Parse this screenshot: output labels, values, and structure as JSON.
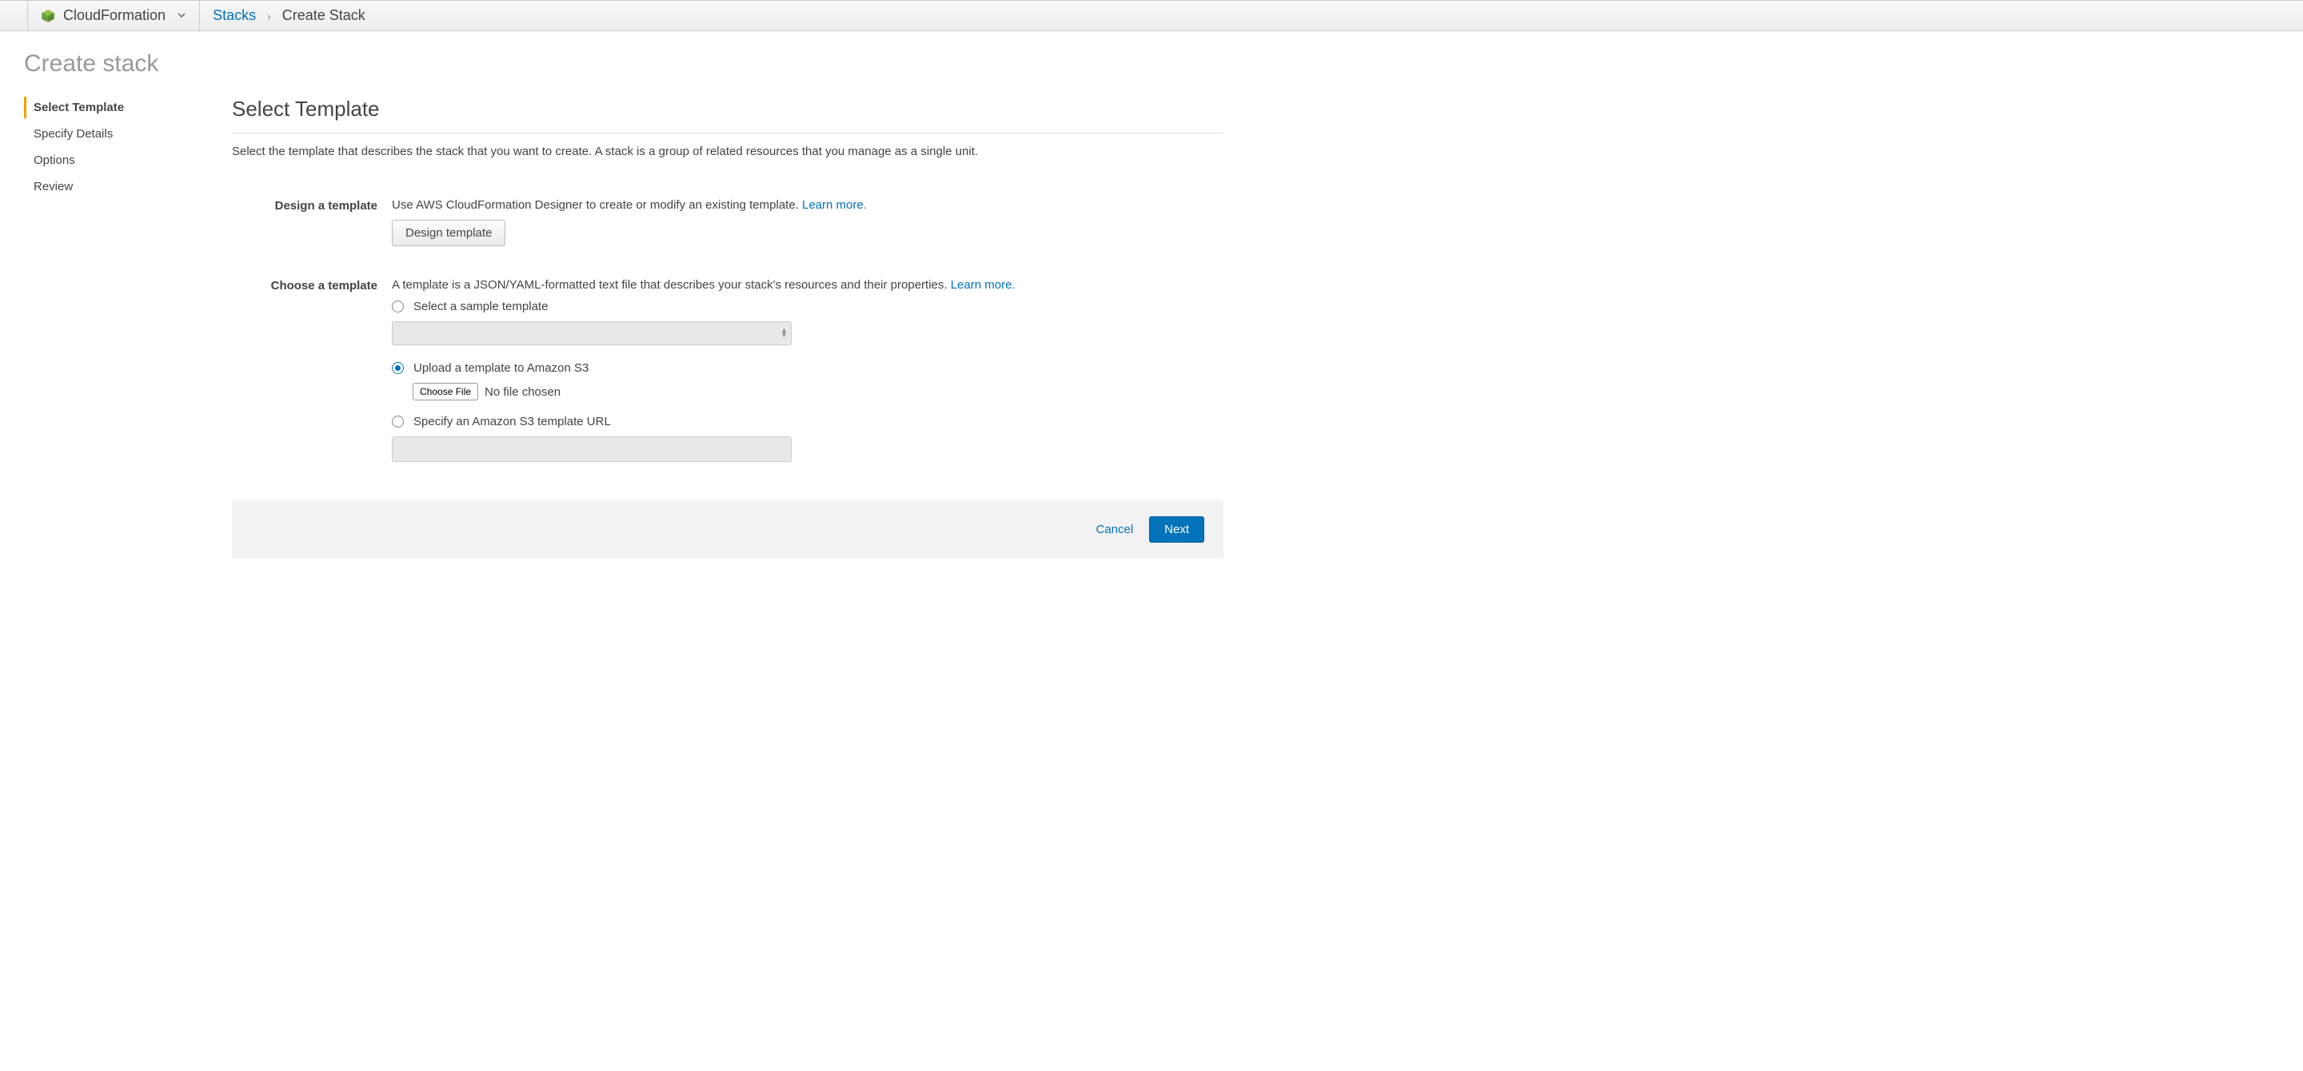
{
  "header": {
    "service": "CloudFormation",
    "breadcrumb": {
      "link": "Stacks",
      "current": "Create Stack"
    }
  },
  "page": {
    "title": "Create stack"
  },
  "steps": [
    {
      "label": "Select Template",
      "active": true
    },
    {
      "label": "Specify Details",
      "active": false
    },
    {
      "label": "Options",
      "active": false
    },
    {
      "label": "Review",
      "active": false
    }
  ],
  "section": {
    "title": "Select Template",
    "description": "Select the template that describes the stack that you want to create. A stack is a group of related resources that you manage as a single unit."
  },
  "design": {
    "label": "Design a template",
    "text": "Use AWS CloudFormation Designer to create or modify an existing template. ",
    "learn_more": "Learn more.",
    "button": "Design template"
  },
  "choose": {
    "label": "Choose a template",
    "text": "A template is a JSON/YAML-formatted text file that describes your stack's resources and their properties. ",
    "learn_more": "Learn more.",
    "options": {
      "sample": "Select a sample template",
      "upload": "Upload a template to Amazon S3",
      "url": "Specify an Amazon S3 template URL"
    },
    "choose_file": "Choose File",
    "no_file": "No file chosen",
    "selected": "upload"
  },
  "footer": {
    "cancel": "Cancel",
    "next": "Next"
  }
}
